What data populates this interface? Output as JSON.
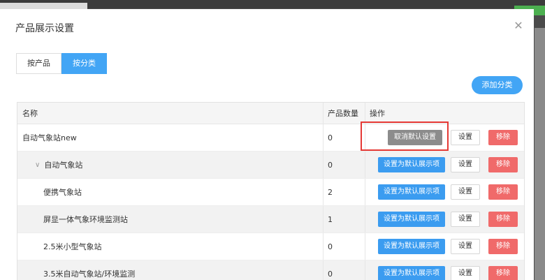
{
  "modal": {
    "title": "产品展示设置",
    "close_icon": "✕"
  },
  "tabs": [
    {
      "label": "按产品",
      "active": false
    },
    {
      "label": "按分类",
      "active": true
    }
  ],
  "add_button": "添加分类",
  "table": {
    "headers": {
      "name": "名称",
      "count": "产品数量",
      "ops": "操作"
    },
    "rows": [
      {
        "name": "自动气象站new",
        "count": "0",
        "primary": "取消默认设置",
        "primary_style": "gray",
        "edit": "设置",
        "remove": "移除",
        "level": 0
      },
      {
        "name": "自动气象站",
        "count": "0",
        "primary": "设置为默认展示项",
        "primary_style": "blue",
        "edit": "设置",
        "remove": "移除",
        "level": 1,
        "toggle": "∨"
      },
      {
        "name": "便携气象站",
        "count": "2",
        "primary": "设置为默认展示项",
        "primary_style": "blue",
        "edit": "设置",
        "remove": "移除",
        "level": 2
      },
      {
        "name": "屏显一体气象环境监测站",
        "count": "1",
        "primary": "设置为默认展示项",
        "primary_style": "blue",
        "edit": "设置",
        "remove": "移除",
        "level": 2
      },
      {
        "name": "2.5米小型气象站",
        "count": "0",
        "primary": "设置为默认展示项",
        "primary_style": "blue",
        "edit": "设置",
        "remove": "移除",
        "level": 2
      },
      {
        "name": "3.5米自动气象站/环境监测",
        "count": "0",
        "primary": "设置为默认展示项",
        "primary_style": "blue",
        "edit": "设置",
        "remove": "移除",
        "level": 2
      }
    ]
  },
  "colors": {
    "accent": "#42a5f5",
    "danger": "#f06a6a",
    "highlight": "#e53935"
  }
}
